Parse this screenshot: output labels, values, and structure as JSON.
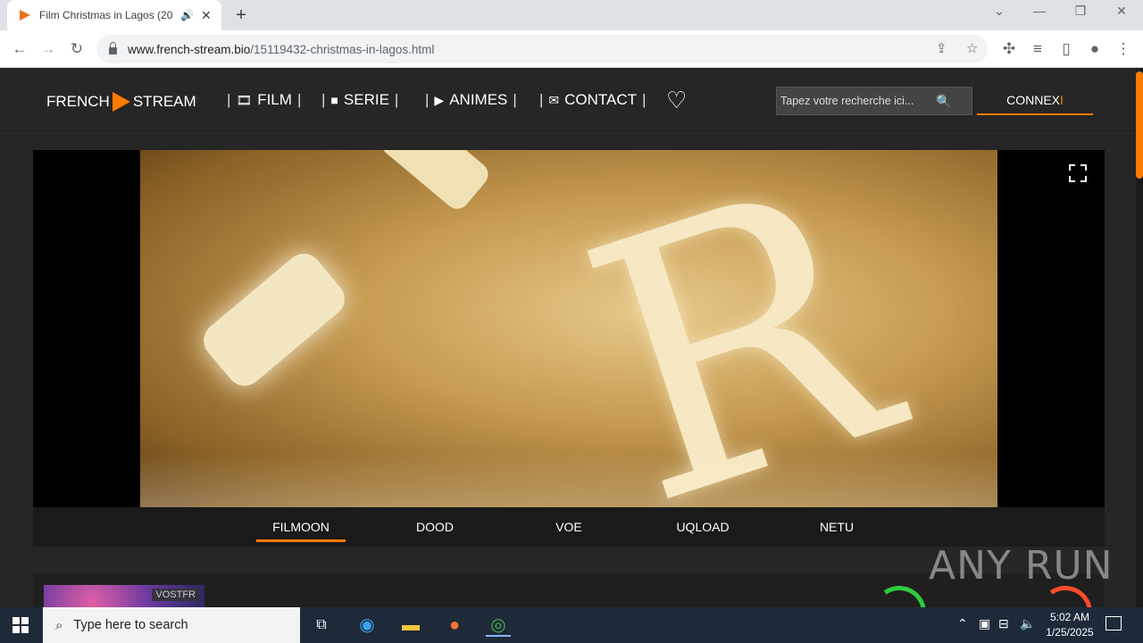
{
  "browser": {
    "tab_title": "Film Christmas in Lagos (20",
    "url_host": "www.french-stream.bio",
    "url_path": "/15119432-christmas-in-lagos.html"
  },
  "site": {
    "logo_left": "FRENCH",
    "logo_right": "STREAM",
    "nav": [
      {
        "label": "FILM",
        "icon": "film-icon"
      },
      {
        "label": "SERIE",
        "icon": "video-camera-icon"
      },
      {
        "label": "ANIMES",
        "icon": "play-circle-icon"
      },
      {
        "label": "CONTACT",
        "icon": "envelope-icon"
      }
    ],
    "search_placeholder": "Tapez votre recherche ici...",
    "connexion_main": "CONNEX",
    "connexion_last": "I",
    "accent_color": "#ff7b00"
  },
  "player": {
    "servers": [
      {
        "label": "FILMOON",
        "active": true
      },
      {
        "label": "DOOD",
        "active": false
      },
      {
        "label": "VOE",
        "active": false
      },
      {
        "label": "UQLOAD",
        "active": false
      },
      {
        "label": "NETU",
        "active": false
      }
    ]
  },
  "card": {
    "badge": "VOSTFR"
  },
  "watermark": "ANY RUN",
  "taskbar": {
    "search_placeholder": "Type here to search",
    "time": "5:02 AM",
    "date": "1/25/2025"
  }
}
